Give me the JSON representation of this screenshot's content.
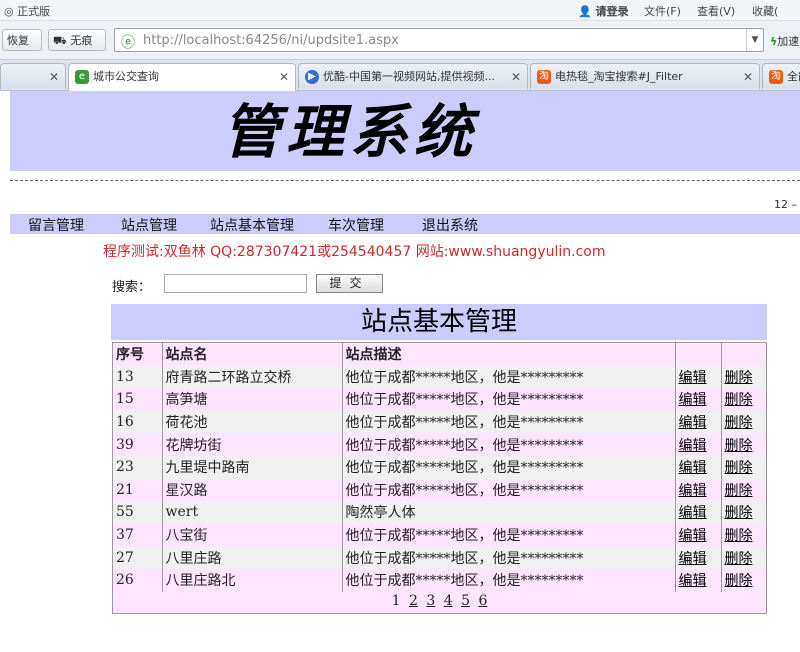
{
  "browser": {
    "title_left": "正式版",
    "login": "请登录",
    "menu_file": "文件(F)",
    "menu_view": "查看(V)",
    "menu_fav": "收藏(",
    "restore": "恢复",
    "no_trace": "无痕",
    "url": "http://localhost:64256/ni/updsite1.aspx",
    "accelerate": "加速",
    "tabs": [
      {
        "label": "城市公交查询",
        "active": true
      },
      {
        "label": "优酷-中国第一视频网站,提供视频...",
        "active": false
      },
      {
        "label": "电热毯_淘宝搜索#J_Filter",
        "active": false
      },
      {
        "label": "全能",
        "active": false
      }
    ]
  },
  "page": {
    "banner_title": "管理系统",
    "page_number": "12 –",
    "menu": [
      "留言管理",
      "站点管理",
      "站点基本管理",
      "车次管理",
      "退出系统"
    ],
    "info": "程序测试:双鱼林 QQ:287307421或254540457 网站:www.shuangyulin.com",
    "search_label": "搜索：",
    "search_value": "",
    "submit": "提交",
    "title": "站点基本管理",
    "table": {
      "headers": [
        "序号",
        "站点名",
        "站点描述",
        "",
        ""
      ],
      "rows": [
        {
          "id": "13",
          "name": "府青路二环路立交桥",
          "desc": "他位于成都*****地区，他是*********",
          "edit": "编辑",
          "del": "删除"
        },
        {
          "id": "15",
          "name": "高笋塘",
          "desc": "他位于成都*****地区，他是*********",
          "edit": "编辑",
          "del": "删除"
        },
        {
          "id": "16",
          "name": "荷花池",
          "desc": "他位于成都*****地区，他是*********",
          "edit": "编辑",
          "del": "删除"
        },
        {
          "id": "39",
          "name": "花牌坊街",
          "desc": "他位于成都*****地区，他是*********",
          "edit": "编辑",
          "del": "删除"
        },
        {
          "id": "23",
          "name": "九里堤中路南",
          "desc": "他位于成都*****地区，他是*********",
          "edit": "编辑",
          "del": "删除"
        },
        {
          "id": "21",
          "name": "星汉路",
          "desc": "他位于成都*****地区，他是*********",
          "edit": "编辑",
          "del": "删除"
        },
        {
          "id": "55",
          "name": "wert",
          "desc": "陶然亭人体",
          "edit": "编辑",
          "del": "删除"
        },
        {
          "id": "37",
          "name": "八宝街",
          "desc": "他位于成都*****地区，他是*********",
          "edit": "编辑",
          "del": "删除"
        },
        {
          "id": "27",
          "name": "八里庄路",
          "desc": "他位于成都*****地区，他是*********",
          "edit": "编辑",
          "del": "删除"
        },
        {
          "id": "26",
          "name": "八里庄路北",
          "desc": "他位于成都*****地区，他是*********",
          "edit": "编辑",
          "del": "删除"
        }
      ]
    },
    "pager": [
      "1",
      "2",
      "3",
      "4",
      "5",
      "6"
    ]
  }
}
